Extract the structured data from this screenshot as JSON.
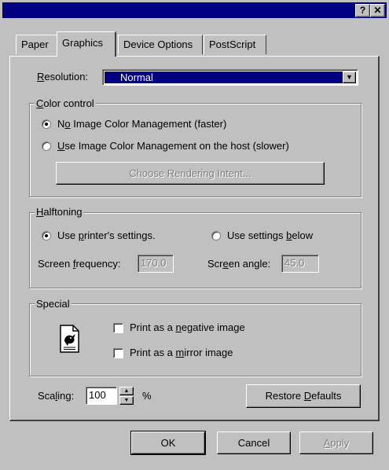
{
  "window": {
    "help_glyph": "?",
    "close_glyph": "✕"
  },
  "tabs": [
    {
      "label": "Paper"
    },
    {
      "label": "Graphics"
    },
    {
      "label": "Device Options"
    },
    {
      "label": "PostScript"
    }
  ],
  "resolution": {
    "label": "Resolution:",
    "value": "Normal"
  },
  "color_control": {
    "title": "Color control",
    "option_no": "No Image Color Management (faster)",
    "option_use": "Use Image Color Management on the host (slower)",
    "selected": "no",
    "rendering_button": "Choose Rendering Intent..."
  },
  "halftoning": {
    "title": "Halftoning",
    "option_printer": "Use printer's settings.",
    "option_below": "Use settings below",
    "selected": "printer",
    "freq_label": "Screen frequency:",
    "freq_value": "170.0",
    "angle_label": "Screen angle:",
    "angle_value": "45.0"
  },
  "special": {
    "title": "Special",
    "negative_label": "Print as a negative image",
    "mirror_label": "Print as a mirror image",
    "negative_checked": false,
    "mirror_checked": false
  },
  "scaling": {
    "label": "Scaling:",
    "value": "100",
    "unit": "%"
  },
  "buttons": {
    "restore": "Restore Defaults",
    "ok": "OK",
    "cancel": "Cancel",
    "apply": "Apply"
  },
  "colors": {
    "title_bar": "#000080",
    "face": "#c0c0c0",
    "selection": "#000080"
  }
}
